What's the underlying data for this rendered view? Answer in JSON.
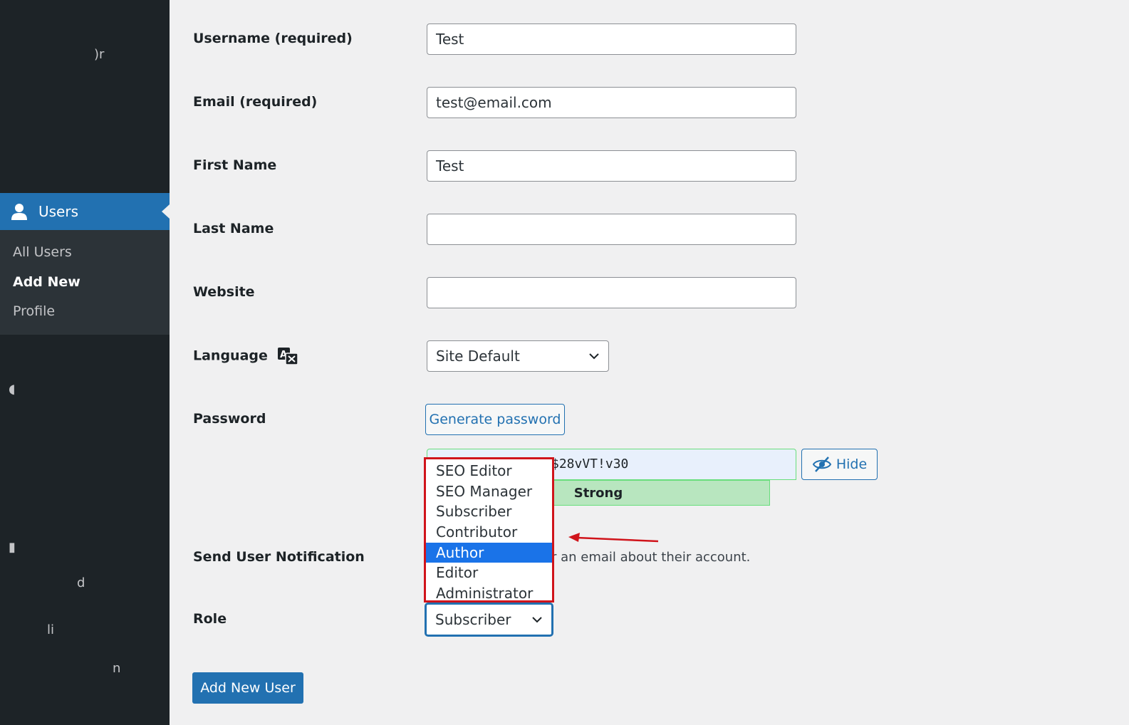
{
  "sidebar": {
    "active_menu": "Users",
    "submenu": [
      "All Users",
      "Add New",
      "Profile"
    ],
    "current_submenu": "Add New"
  },
  "form": {
    "username": {
      "label": "Username (required)",
      "value": "Test"
    },
    "email": {
      "label": "Email (required)",
      "value": "test@email.com"
    },
    "first_name": {
      "label": "First Name",
      "value": "Test"
    },
    "last_name": {
      "label": "Last Name",
      "value": ""
    },
    "website": {
      "label": "Website",
      "value": ""
    },
    "language": {
      "label": "Language",
      "value": "Site Default"
    },
    "password": {
      "label": "Password",
      "generate_label": "Generate password",
      "visible_value": "$28vVT!v30",
      "strength": "Strong",
      "hide_label": "Hide"
    },
    "notification": {
      "label": "Send User Notification",
      "visible_text": "r an email about their account."
    },
    "role": {
      "label": "Role",
      "value": "Subscriber",
      "options": [
        "SEO Editor",
        "SEO Manager",
        "Subscriber",
        "Contributor",
        "Author",
        "Editor",
        "Administrator"
      ],
      "highlighted": "Author"
    },
    "submit_label": "Add New User"
  },
  "colors": {
    "sidebar_bg": "#1d2327",
    "accent": "#2271b1",
    "annotation": "#d0141b",
    "strength_bg": "#b8e6bf"
  }
}
